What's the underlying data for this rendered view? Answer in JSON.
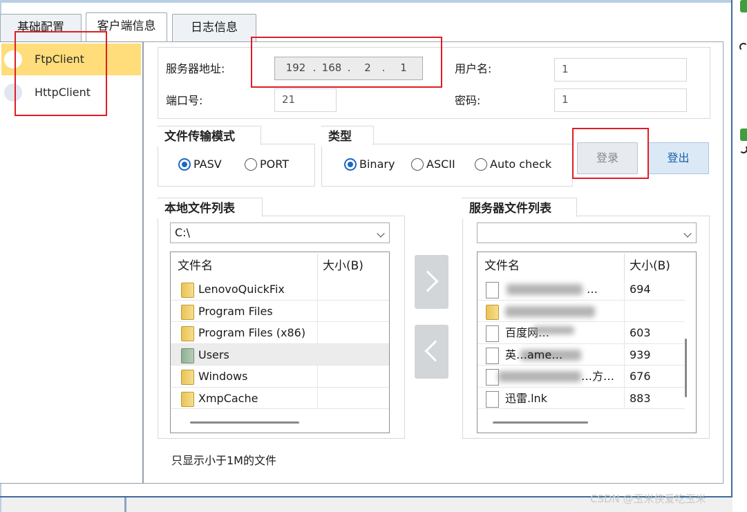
{
  "tabs": [
    "基础配置",
    "客户端信息",
    "日志信息"
  ],
  "nav_items": [
    "FtpClient",
    "HttpClient"
  ],
  "server": {
    "address_label": "服务器地址:",
    "ip": [
      "192",
      "168",
      "2",
      "1"
    ],
    "ip_dot": ".",
    "port_label": "端口号:",
    "port_value": "21",
    "user_label": "用户名:",
    "user_value": "1",
    "password_label": "密码:",
    "password_value": "1"
  },
  "transfer_mode": {
    "title": "文件传输模式",
    "options": [
      "PASV",
      "PORT"
    ],
    "selected": "PASV"
  },
  "type": {
    "title": "类型",
    "options": [
      "Binary",
      "ASCII",
      "Auto check"
    ],
    "selected": "Binary"
  },
  "buttons": {
    "login": "登录",
    "logout": "登出"
  },
  "local_list": {
    "title": "本地文件列表",
    "path": "C:\\",
    "col_name": "文件名",
    "col_size": "大小(B)",
    "rows": [
      {
        "name": "LenovoQuickFix",
        "icon": "folder-icon",
        "size": ""
      },
      {
        "name": "Program Files",
        "icon": "folder-icon",
        "size": ""
      },
      {
        "name": "Program Files (x86)",
        "icon": "folder-icon",
        "size": ""
      },
      {
        "name": "Users",
        "icon": "user-folder-icon",
        "size": ""
      },
      {
        "name": "Windows",
        "icon": "folder-icon",
        "size": ""
      },
      {
        "name": "XmpCache",
        "icon": "folder-icon",
        "size": ""
      }
    ]
  },
  "server_list": {
    "title": "服务器文件列表",
    "path": "",
    "col_name": "文件名",
    "col_size": "大小(B)",
    "rows": [
      {
        "name": "…",
        "icon": "file-icon",
        "size": "694"
      },
      {
        "name": "",
        "icon": "folder-icon",
        "size": ""
      },
      {
        "name": "百度网…",
        "icon": "file-icon",
        "size": "603"
      },
      {
        "name": "英…ame…",
        "icon": "file-icon",
        "size": "939"
      },
      {
        "name": "…方…",
        "icon": "file-icon",
        "size": "676"
      },
      {
        "name": "迅雷.lnk",
        "icon": "file-icon",
        "size": "883"
      }
    ]
  },
  "footer_note": "只显示小于1M的文件",
  "watermark": "CSDN @玉米侠爱吃玉米"
}
